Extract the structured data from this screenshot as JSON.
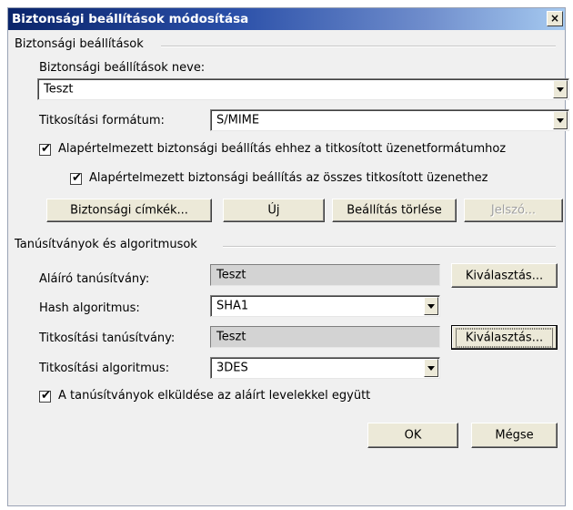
{
  "dialog": {
    "title": "Biztonsági beállítások módosítása",
    "close_label": "×"
  },
  "security_settings": {
    "section_label": "Biztonsági beállítások",
    "name_label": "Biztonsági beállítások neve:",
    "name_value": "Teszt",
    "format_label": "Titkosítási formátum:",
    "format_value": "S/MIME",
    "default_format_label": "Alapértelmezett biztonsági beállítás ehhez a titkosított üzenetformátumhoz",
    "default_format_checked": true,
    "default_all_label": "Alapértelmezett biztonsági beállítás az összes titkosított üzenethez",
    "default_all_checked": true,
    "buttons": {
      "labels": "Biztonsági címkék...",
      "new": "Új",
      "delete": "Beállítás törlése",
      "password": "Jelszó..."
    }
  },
  "certs": {
    "section_label": "Tanúsítványok és algoritmusok",
    "signing_cert_label": "Aláíró tanúsítvány:",
    "signing_cert_value": "Teszt",
    "choose_label": "Kiválasztás...",
    "hash_label": "Hash algoritmus:",
    "hash_value": "SHA1",
    "enc_cert_label": "Titkosítási tanúsítvány:",
    "enc_cert_value": "Teszt",
    "enc_alg_label": "Titkosítási algoritmus:",
    "enc_alg_value": "3DES",
    "send_certs_label": "A tanúsítványok elküldése az aláírt levelekkel együtt",
    "send_certs_checked": true
  },
  "footer": {
    "ok": "OK",
    "cancel": "Mégse"
  },
  "check_glyph": "✔"
}
